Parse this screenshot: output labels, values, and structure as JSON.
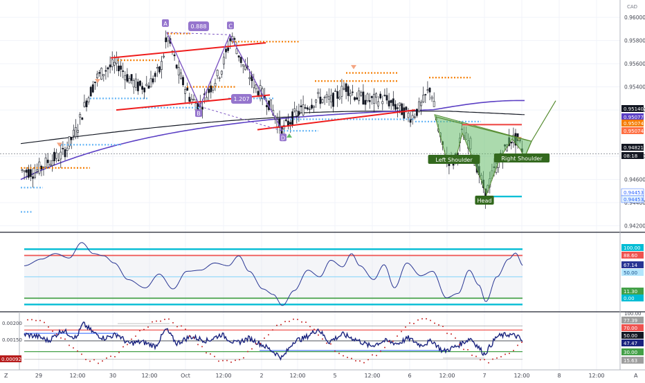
{
  "chart_data": [
    {
      "type": "candlestick",
      "pane": "price",
      "ylim": [
        0.9415,
        0.9615
      ],
      "x_ticks": [
        "29",
        "12:00",
        "30",
        "12:00",
        "Oct",
        "12:00",
        "2",
        "12:00",
        "5",
        "12:00",
        "6",
        "12:00",
        "7",
        "12:00",
        "8",
        "12:00"
      ],
      "y_ticks": [
        0.96,
        0.958,
        0.956,
        0.954,
        0.952,
        0.948,
        0.946,
        0.944,
        0.942
      ],
      "price_badges": [
        {
          "label": "0.95140",
          "value": 0.9514,
          "color": "#131722"
        },
        {
          "label": "0.95077",
          "value": 0.95077,
          "color": "#5b3fc4"
        },
        {
          "label": "0.95074",
          "value": 0.95074,
          "color": "#f57c00"
        },
        {
          "label": "0.95074",
          "value": 0.95074,
          "color": "#ff7043"
        },
        {
          "label": "0.94821",
          "value": 0.94821,
          "color": "#131722"
        },
        {
          "label": "08:18",
          "value": 0.94792,
          "color": "#131722"
        },
        {
          "label": "0.94453",
          "value": 0.94453,
          "color": "#ffffff",
          "text": "#2962ff"
        },
        {
          "label": "0.94453",
          "value": 0.94453,
          "color": "#e3f2fd",
          "text": "#2962ff"
        }
      ],
      "currency": "CAD",
      "harmonic_points": [
        {
          "label": "A",
          "value": 0.9587
        },
        {
          "label": "B",
          "value": 0.9523
        },
        {
          "label": "C",
          "value": 0.9586
        },
        {
          "label": "D",
          "value": 0.9502
        }
      ],
      "ratios": [
        "0.888",
        "1.207"
      ],
      "pattern_labels": [
        "Left Shoulder",
        "Head",
        "Right Shoulder"
      ],
      "levels": {
        "neckline": 0.95074,
        "head_low": 0.94453,
        "current": 0.94821
      }
    },
    {
      "type": "line",
      "pane": "oscillator-1",
      "ylim": [
        -12,
        128
      ],
      "badges": [
        {
          "label": "100.00",
          "value": 100,
          "color": "#00bcd4"
        },
        {
          "label": "88.60",
          "value": 88.6,
          "color": "#ef5350"
        },
        {
          "label": "67.14",
          "value": 67.14,
          "color": "#283593"
        },
        {
          "label": "50.00",
          "value": 50,
          "color": "#b3e5fc",
          "text": "#1a4f8a"
        },
        {
          "label": "11.30",
          "value": 11.3,
          "color": "#43a047"
        },
        {
          "label": "0.00",
          "value": 0,
          "color": "#00bcd4"
        }
      ]
    },
    {
      "type": "line",
      "pane": "oscillator-2",
      "left_ticks": [
        "0.00200",
        "0.00150"
      ],
      "left_badge": "0.00092",
      "right_ticks": [
        "100.00",
        "50.00"
      ],
      "badges": [
        {
          "label": "77.39",
          "value": 77.39,
          "color": "#9e9e9e"
        },
        {
          "label": "70.00",
          "value": 70,
          "color": "#ef5350"
        },
        {
          "label": "50.00",
          "value": 50,
          "color": "#131722"
        },
        {
          "label": "47.47",
          "value": 47.47,
          "color": "#1a237e"
        },
        {
          "label": "30.00",
          "value": 30,
          "color": "#43a047"
        },
        {
          "label": "15.63",
          "value": 15.63,
          "color": "#9e9e9e"
        }
      ]
    }
  ],
  "footer": {
    "left": "Z",
    "right": "A"
  }
}
